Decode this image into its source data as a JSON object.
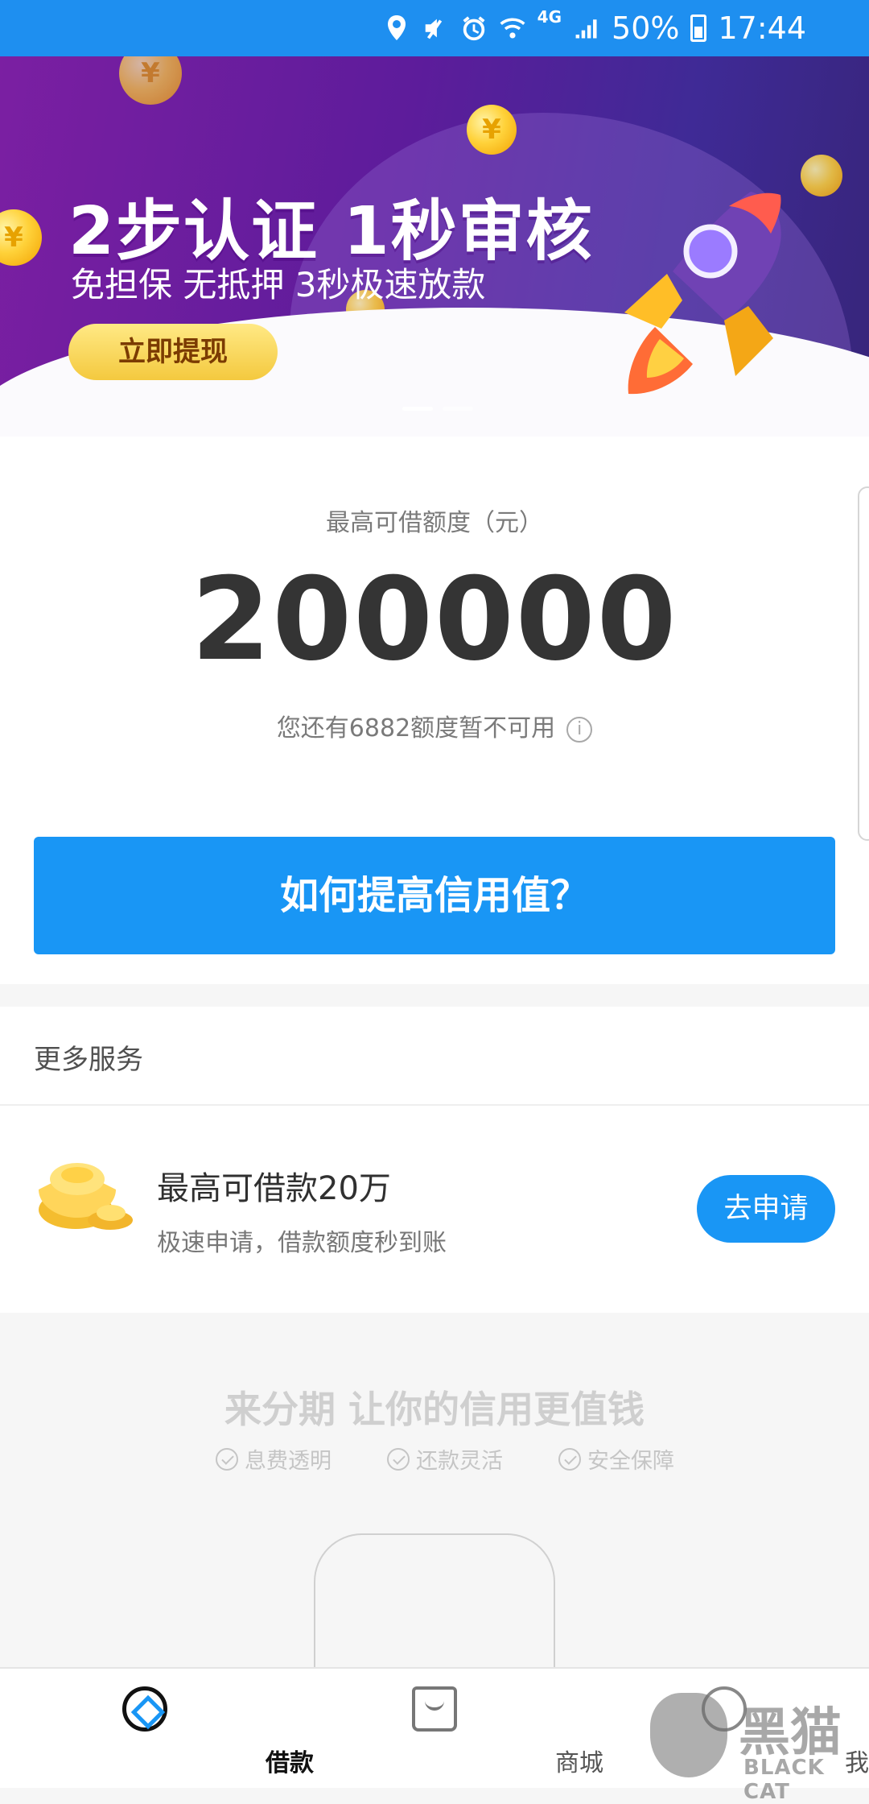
{
  "status_bar": {
    "battery": "50%",
    "time": "17:44",
    "network": "4G",
    "icons": [
      "location-icon",
      "mute-icon",
      "alarm-icon",
      "wifi-icon",
      "signal-icon",
      "battery-icon"
    ]
  },
  "banner": {
    "title": "2步认证 1秒审核",
    "subtitle": "免担保 无抵押 3秒极速放款",
    "button": "立即提现",
    "icons": [
      "coin-icon",
      "rocket-icon"
    ],
    "active_slide": 1,
    "slide_count": 2
  },
  "credit": {
    "label": "最高可借额度（元）",
    "amount": "200000",
    "unavailable": "您还有6882额度暂不可用",
    "info_icon": "info-icon",
    "button": "如何提高信用值？"
  },
  "services": {
    "title": "更多服务",
    "item": {
      "title": "最高可借款20万",
      "description": "极速申请，借款额度秒到账",
      "button": "去申请",
      "icon": "gold-ingot-icon"
    }
  },
  "promo": {
    "slogan": "来分期 让你的信用更值钱",
    "features": [
      "息费透明",
      "还款灵活",
      "安全保障"
    ]
  },
  "tabs": [
    {
      "label": "借款",
      "icon": "loan-icon",
      "active": true
    },
    {
      "label": "商城",
      "icon": "shopping-bag-icon",
      "active": false
    },
    {
      "label": "我的",
      "icon": "profile-icon",
      "active": false
    }
  ],
  "watermark": {
    "main": "黑猫",
    "sub": "BLACK CAT"
  },
  "colors": {
    "status_bar": "#1e8ff0",
    "primary": "#1996f5",
    "banner_purple": "#7b1fa2",
    "gold": "#f4c93f"
  }
}
